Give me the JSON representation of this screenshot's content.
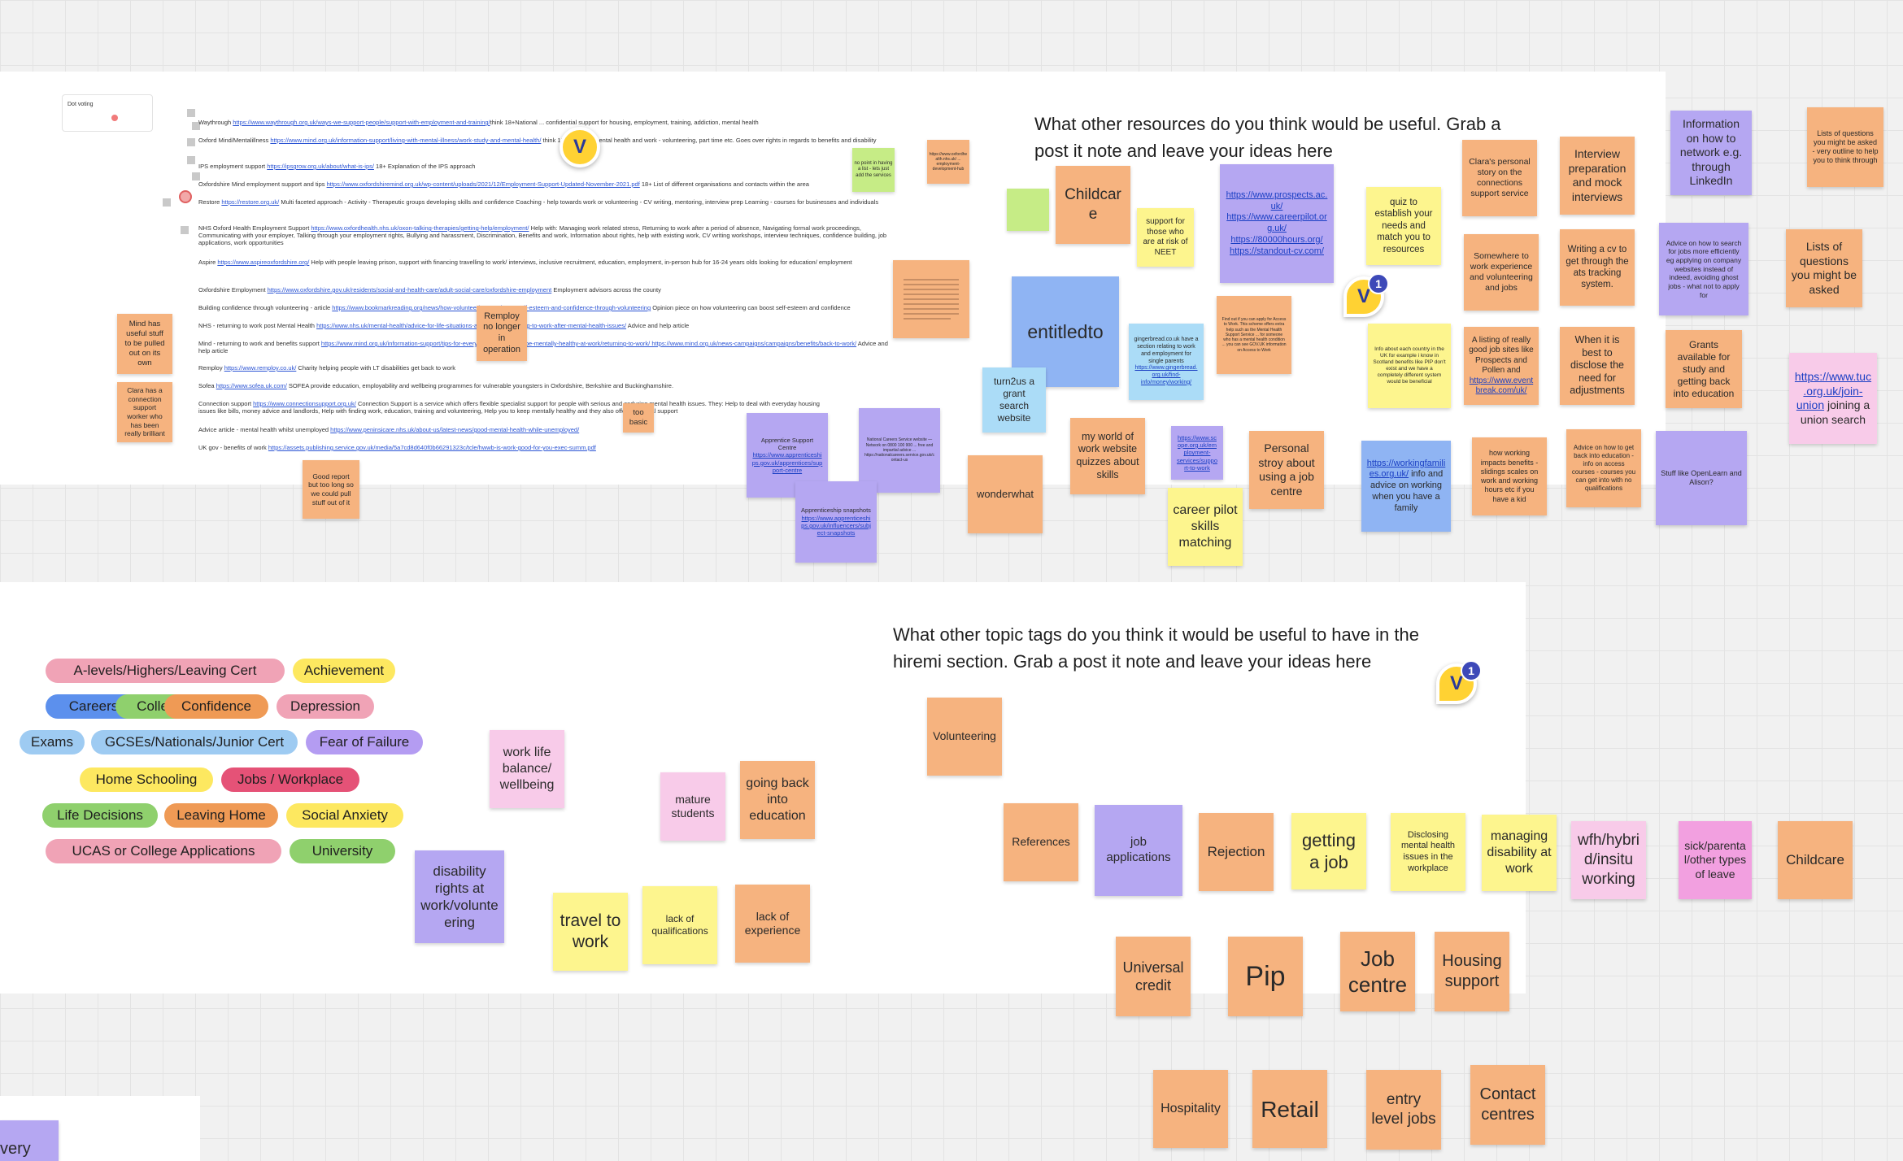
{
  "resources": {
    "heading": "What other resources do you think would be useful. Grab a post it note and leave your ideas here",
    "dot_voting_label": "Dot voting",
    "doc_lines": [
      {
        "pre": "Waythrough ",
        "link": "https://www.waythrough.org.uk/ways-we-support-people/support-with-employment-and-training/",
        "post": "think 18+National ... confidential support for housing, employment, training, addiction, mental health"
      },
      {
        "pre": "Oxford Mind/Mentalillness ",
        "link": "https://www.mind.org.uk/information-support/living-with-mental-illness/work-study-and-mental-health/",
        "post": " think 15+ Page on mental health and work - volunteering, part time etc. Goes over rights in regards to benefits and disability"
      },
      {
        "pre": "IPS employment support ",
        "link": "https://ipsgrow.org.uk/about/what-is-ips/",
        "post": " 18+ Explanation of the IPS approach"
      },
      {
        "pre": "Oxfordshire Mind employment support and tips ",
        "link": "https://www.oxfordshiremind.org.uk/wp-content/uploads/2021/12/Employment-Support-Updated-November-2021.pdf",
        "post": " 18+ List of different organisations and contacts within the area"
      },
      {
        "pre": "Restore ",
        "link": "https://restore.org.uk/",
        "post": " Multi faceted approach - Activity - Therapeutic groups developing skills and confidence Coaching - help towards work or volunteering - CV writing, mentoring, interview prep Learning - courses for businesses and individuals"
      },
      {
        "pre": "NHS Oxford Health Employment Support ",
        "link": "https://www.oxfordhealth.nhs.uk/oxon-talking-therapies/getting-help/employment/",
        "post": " Help with: Managing work related stress, Returning to work after a period of absence, Navigating formal work proceedings, Communicating with your employer, Talking through your employment rights, Bullying and harassment, Discrimination, Benefits and work, Information about rights, help with existing work, CV writing workshops, interview techniques, confidence building, job applications, work opportunities"
      },
      {
        "pre": "Aspire ",
        "link": "https://www.aspireoxfordshire.org/",
        "post": " Help with people leaving prison, support with financing travelling to work/ interviews, inclusive recruitment, education, employment, in-person hub for 16-24 years olds looking for education/ employment"
      },
      {
        "pre": "Oxfordshire Employment ",
        "link": "https://www.oxfordshire.gov.uk/residents/social-and-health-care/adult-social-care/oxfordshire-employment",
        "post": " Employment advisors across the county"
      },
      {
        "pre": "Building confidence through volunteering - article ",
        "link": "https://www.bookmarkreading.org/news/how-volunteering-can-boost-self-esteem-and-confidence-through-volunteering",
        "post": " Opinion piece on how volunteering can boost self-esteem and confidence"
      },
      {
        "pre": "NHS - returning to work post Mental Health ",
        "link": "https://www.nhs.uk/mental-health/advice-for-life-situations-and-events/returning-to-work-after-mental-health-issues/",
        "post": " Advice and help article"
      },
      {
        "pre": "Mind - returning to work and benefits support ",
        "link": "https://www.mind.org.uk/information-support/tips-for-everyday-living/how-to-be-mentally-healthy-at-work/returning-to-work/ https://www.mind.org.uk/news-campaigns/campaigns/benefits/back-to-work/",
        "post": " Advice and help article"
      },
      {
        "pre": "Remploy ",
        "link": "https://www.remploy.co.uk/",
        "post": " Charity helping people with LT disabilities get back to work"
      },
      {
        "pre": "Sofea ",
        "link": "https://www.sofea.uk.com/",
        "post": " SOFEA provide education, employability and wellbeing programmes for vulnerable youngsters in Oxfordshire, Berkshire and Buckinghamshire."
      },
      {
        "pre": "Connection support ",
        "link": "https://www.connectionsupport.org.uk/",
        "post": " Connection Support is a service which offers flexible specialist support for people with serious and enduring mental health issues. They: Help to deal with everyday housing issues like bills, money advice and landlords, Help with finding work, education, training and volunteering, Help you to keep mentally healthy and they also offer emotional support"
      },
      {
        "pre": "Advice article - mental health whilst unemployed ",
        "link": "https://www.peninsicare.nhs.uk/about-us/latest-news/good-mental-health-while-unemployed/",
        "post": ""
      },
      {
        "pre": "UK gov - benefits of work ",
        "link": "https://assets.publishing.service.gov.uk/media/5a7cd8d640f0b66291323c/tcle/hwwb-is-work-good-for-you-exec-summ.pdf",
        "post": ""
      }
    ],
    "notes": [
      {
        "text": "Mind has useful stuff to be pulled out on its own"
      },
      {
        "text": "Clara has a connection support worker who has been really brilliant"
      },
      {
        "text": "Good report but too long so we could pull stuff out of it"
      },
      {
        "text": "Remploy no longer in operation"
      },
      {
        "text": "too basic"
      },
      {
        "text": "no point in having a list - lets just add the services"
      },
      {
        "text": "https://www.oxfordhealth.nhs.uk/ ... employment-development-hub"
      },
      {
        "text": "Apprentice Support Centre ",
        "link": "https://www.apprenticeships.gov.uk/apprentices/support-centre"
      },
      {
        "text": "National Careers Service website — Network on 0800 100 900 ... free and impartial advice ... https://nationalcareers.service.gov.uk/contact-us"
      },
      {
        "text": "Apprenticeship snapshots ",
        "link": "https://www.apprenticeships.gov.uk/influencers/subject-snapshots"
      },
      {
        "text": "wonderwhat"
      },
      {
        "text": "Childcare"
      },
      {
        "text": "support for those who are at risk of NEET"
      },
      {
        "text": "entitledto"
      },
      {
        "text": "turn2us a grant search website"
      },
      {
        "text": "my world of work website quizzes about skills"
      },
      {
        "text": "gingerbread.co.uk have a section relating to work and employment for single parents ",
        "link": "https://www.gingerbread.org.uk/find-info/money/working/"
      },
      {
        "text": "",
        "link": "https://www.prospects.ac.uk/ https://www.careerpilot.org.uk/ https://80000hours.org/ https://standout-cv.com/"
      },
      {
        "text": "Find out if you can apply for Access to Work. This scheme offers extra help such as the Mental Health Support Service ... for someone who has a mental health condition ... you can see GOV.UK information on Access to Work"
      },
      {
        "text": "",
        "link": "https://www.scope.org.uk/employment-services/support-to-work"
      },
      {
        "text": "career pilot skills matching"
      },
      {
        "text": "Personal stroy about using a job centre"
      },
      {
        "text": "quiz to establish your needs and match you to resources"
      },
      {
        "text": "Info about each country in the UK for example i know in Scotland benefits like PIP don't exist and we have a completely different system would be beneficial"
      },
      {
        "text": "",
        "link": "https://workingfamilies.org.uk/",
        "post": " info and advice on working when you have a family"
      },
      {
        "text": "Clara's personal story on the connections support service"
      },
      {
        "text": "Somewhere to work experience and volunteering and jobs"
      },
      {
        "text": "A listing of really good job sites like Prospects and Pollen and ",
        "link": "https://www.eventbreak.com/uk/"
      },
      {
        "text": "how working impacts benefits - slidings scales on work and working hours etc if you have a kid"
      },
      {
        "text": "Interview preparation and mock interviews"
      },
      {
        "text": "Writing a cv to get through the ats tracking system."
      },
      {
        "text": "When it is best to disclose the need for adjustments"
      },
      {
        "text": "Advice on how to get back into education - info on access courses - courses you can get into with no qualifications"
      },
      {
        "text": "Information on how to network e.g. through LinkedIn"
      },
      {
        "text": "Advice on how to search for jobs more efficiently eg applying on company websites instead of indeed, avoiding ghost jobs - what not to apply for"
      },
      {
        "text": "Grants available for study and getting back into education"
      },
      {
        "text": "Stuff like OpenLearn and Alison?"
      },
      {
        "text": "Lists of questions you might be asked - very outline to help you to think through"
      },
      {
        "text": "Lists of questions you might be asked"
      },
      {
        "text": " joining a union search",
        "link": "https://www.tuc.org.uk/join-union"
      }
    ]
  },
  "tags": {
    "heading": "What other topic tags do you think it would be useful to have in the hiremi section. Grab a post it note and leave your ideas here",
    "chips": [
      {
        "label": "A-levels/Highers/Leaving Cert",
        "color": "#f0a3b6"
      },
      {
        "label": "Achievement",
        "color": "#fde860"
      },
      {
        "label": "Careers",
        "color": "#5c90ed"
      },
      {
        "label": "College",
        "color": "#8fd06d"
      },
      {
        "label": "Confidence",
        "color": "#ef9a55"
      },
      {
        "label": "Depression",
        "color": "#f0a3b6"
      },
      {
        "label": "Exams",
        "color": "#9ecbf2"
      },
      {
        "label": "GCSEs/Nationals/Junior Cert",
        "color": "#9ecbf2"
      },
      {
        "label": "Fear of Failure",
        "color": "#b49cf2"
      },
      {
        "label": "Home Schooling",
        "color": "#fde860"
      },
      {
        "label": "Jobs / Workplace",
        "color": "#e55277"
      },
      {
        "label": "Life Decisions",
        "color": "#8fd06d"
      },
      {
        "label": "Leaving Home",
        "color": "#ef9a55"
      },
      {
        "label": "Social Anxiety",
        "color": "#fde860"
      },
      {
        "label": "UCAS or College Applications",
        "color": "#f0a3b6"
      },
      {
        "label": "University",
        "color": "#8fd06d"
      }
    ],
    "notes": [
      {
        "text": "work life balance/ wellbeing"
      },
      {
        "text": "disability rights at work/volunteering"
      },
      {
        "text": "mature students"
      },
      {
        "text": "going back into education"
      },
      {
        "text": "travel to work"
      },
      {
        "text": "lack of qualifications"
      },
      {
        "text": "lack of experience"
      },
      {
        "text": "Volunteering"
      },
      {
        "text": "References"
      },
      {
        "text": "job applications"
      },
      {
        "text": "Rejection"
      },
      {
        "text": "getting a job"
      },
      {
        "text": "Disclosing mental health issues in the workplace"
      },
      {
        "text": "managing disability at work"
      },
      {
        "text": "wfh/hybrid/insitu working"
      },
      {
        "text": "sick/parental/other types of leave"
      },
      {
        "text": "Childcare"
      },
      {
        "text": "Universal credit"
      },
      {
        "text": "Pip"
      },
      {
        "text": "Job centre"
      },
      {
        "text": "Housing support"
      },
      {
        "text": "Hospitality"
      },
      {
        "text": "Retail"
      },
      {
        "text": "entry level jobs"
      },
      {
        "text": "Contact centres"
      }
    ]
  },
  "offscreen": {
    "partial_note": "very"
  },
  "cursors": [
    {
      "initial": "V",
      "badge": ""
    },
    {
      "initial": "V",
      "badge": "1"
    },
    {
      "initial": "V",
      "badge": "1"
    }
  ]
}
